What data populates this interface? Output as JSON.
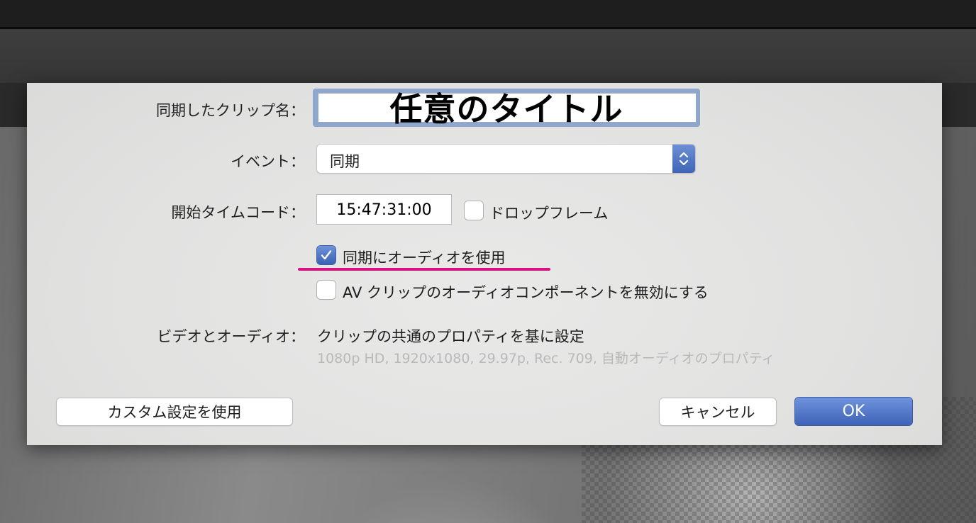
{
  "dialog": {
    "clip_name_label": "同期したクリップ名：",
    "clip_name_value": "任意のタイトル",
    "event_label": "イベント：",
    "event_value": "同期",
    "timecode_label": "開始タイムコード：",
    "timecode_value": "15:47:31:00",
    "drop_frame_label": "ドロップフレーム",
    "drop_frame_checked": false,
    "use_audio_sync_label": "同期にオーディオを使用",
    "use_audio_sync_checked": true,
    "disable_av_audio_label": "AV クリップのオーディオコンポーネントを無効にする",
    "disable_av_audio_checked": false,
    "video_audio_label": "ビデオとオーディオ：",
    "video_audio_value": "クリップの共通のプロパティを基に設定",
    "video_audio_details": "1080p HD, 1920x1080, 29.97p, Rec. 709, 自動オーディオのプロパティ",
    "custom_settings_button": "カスタム設定を使用",
    "cancel_button": "キャンセル",
    "ok_button": "OK"
  },
  "colors": {
    "accent": "#4a6fc4",
    "highlight_underline": "#d6137f"
  },
  "icons": {
    "popup": "chevron-up-down-icon",
    "checkmark": "checkmark-icon"
  }
}
